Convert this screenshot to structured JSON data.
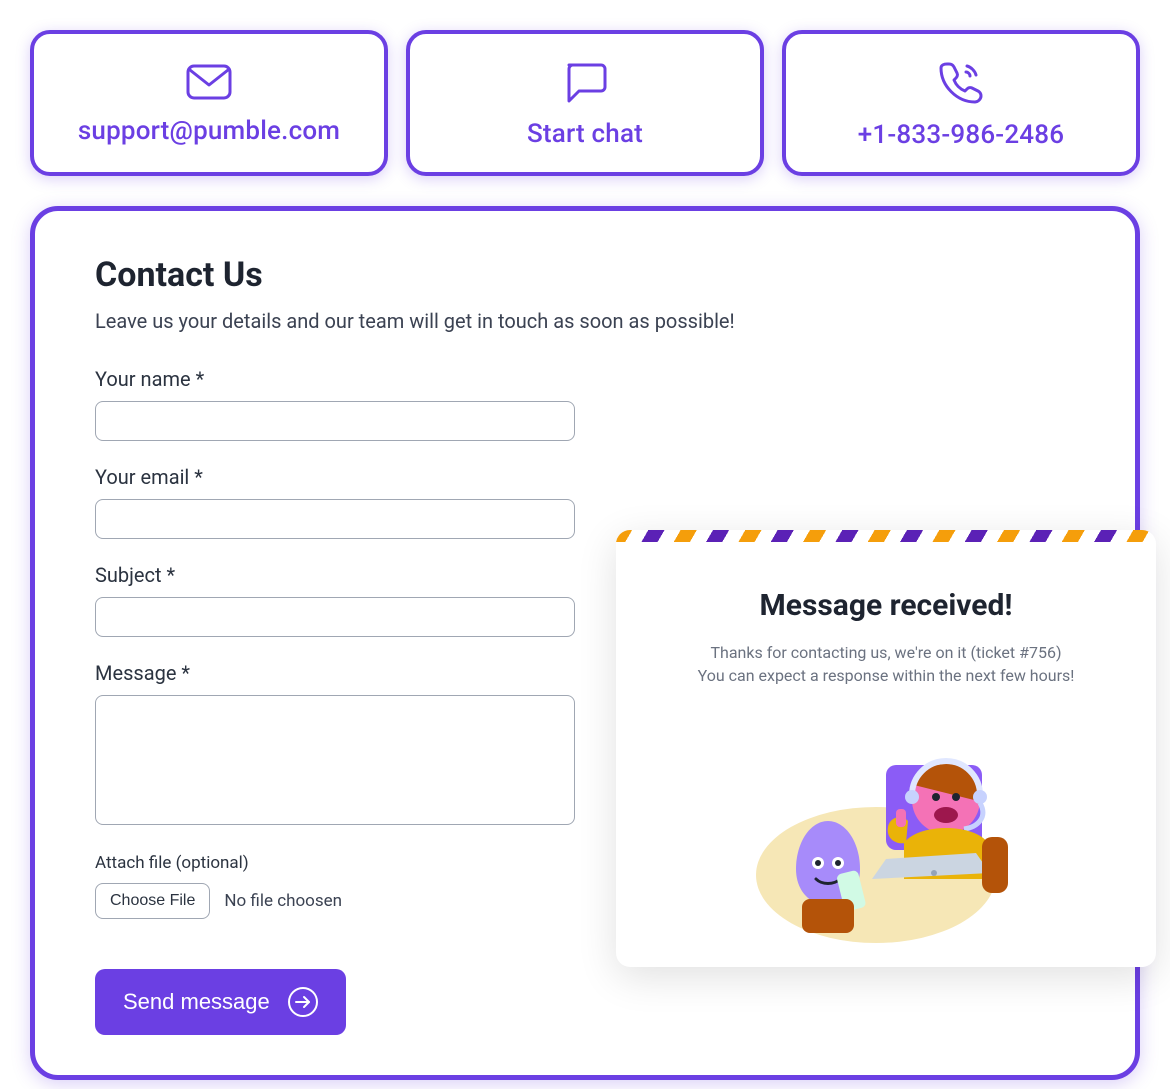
{
  "contacts": {
    "email": {
      "icon": "mail-icon",
      "label": "support@pumble.com"
    },
    "chat": {
      "icon": "chat-icon",
      "label": "Start chat"
    },
    "phone": {
      "icon": "phone-icon",
      "label": "+1-833-986-2486"
    }
  },
  "form": {
    "title": "Contact Us",
    "subtitle": "Leave us your details and our team will get in touch as soon as possible!",
    "name_label": "Your name *",
    "email_label": "Your email *",
    "subject_label": "Subject *",
    "message_label": "Message *",
    "attach_label": "Attach file (optional)",
    "file_button": "Choose File",
    "file_status": "No file choosen",
    "send_label": "Send message"
  },
  "toast": {
    "title": "Message received!",
    "line1": "Thanks for contacting us, we're on it (ticket #756)",
    "line2": "You can expect a response within the next few hours!"
  },
  "colors": {
    "accent": "#6B3FE3",
    "text_dark": "#1E2430",
    "text_muted": "#6B7280"
  }
}
